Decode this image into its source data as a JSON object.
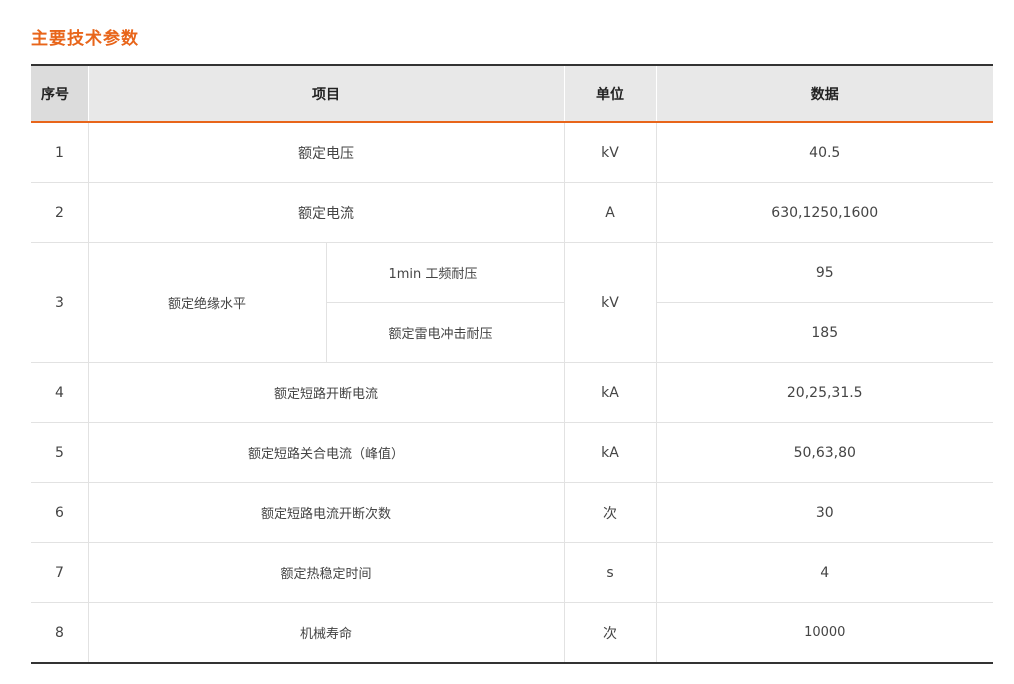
{
  "title": "主要技术参数",
  "headers": {
    "no": "序号",
    "item": "项目",
    "unit": "单位",
    "data": "数据"
  },
  "rows": [
    {
      "no": "1",
      "item": "额定电压",
      "unit": "kV",
      "data": "40.5"
    },
    {
      "no": "2",
      "item": "额定电流",
      "unit": "A",
      "data": "630,1250,1600"
    },
    {
      "no": "3",
      "item": "额定绝缘水平",
      "unit": "kV",
      "sub": [
        {
          "item": "1min 工频耐压",
          "data": "95"
        },
        {
          "item": "额定雷电冲击耐压",
          "data": "185"
        }
      ]
    },
    {
      "no": "4",
      "item": "额定短路开断电流",
      "unit": "kA",
      "data": "20,25,31.5"
    },
    {
      "no": "5",
      "item": "额定短路关合电流（峰值）",
      "unit": "kA",
      "data": "50,63,80"
    },
    {
      "no": "6",
      "item": "额定短路电流开断次数",
      "unit": "次",
      "data": "30"
    },
    {
      "no": "7",
      "item": "额定热稳定时间",
      "unit": "s",
      "data": "4"
    },
    {
      "no": "8",
      "item": "机械寿命",
      "unit": "次",
      "data": "10000"
    }
  ]
}
